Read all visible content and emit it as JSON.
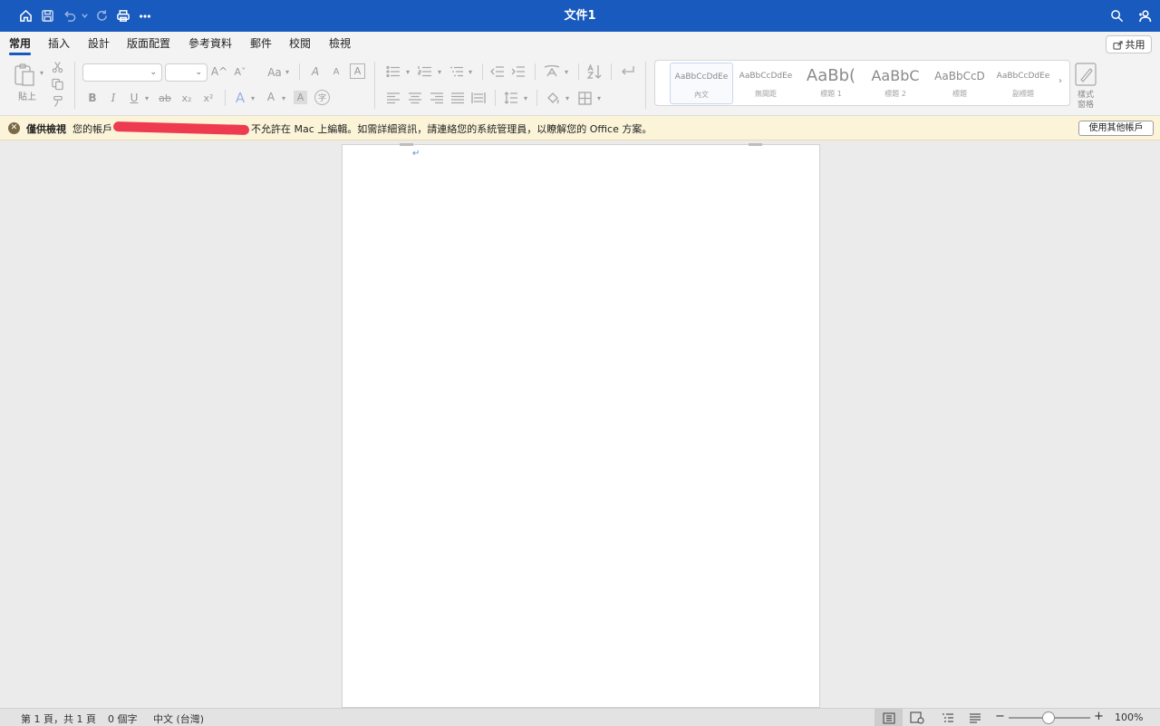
{
  "window": {
    "title": "文件1"
  },
  "tabs": [
    {
      "label": "常用",
      "active": true
    },
    {
      "label": "插入"
    },
    {
      "label": "設計"
    },
    {
      "label": "版面配置"
    },
    {
      "label": "參考資料"
    },
    {
      "label": "郵件"
    },
    {
      "label": "校閱"
    },
    {
      "label": "檢視"
    }
  ],
  "share": {
    "label": "共用"
  },
  "ribbon": {
    "paste_label": "貼上",
    "font_name": "",
    "font_size": "",
    "styles": [
      {
        "sample": "AaBbCcDdEe",
        "name": "內文",
        "selected": true
      },
      {
        "sample": "AaBbCcDdEe",
        "name": "無間距"
      },
      {
        "sample": "AaBb(",
        "name": "標題 1"
      },
      {
        "sample": "AaBbC",
        "name": "標題 2"
      },
      {
        "sample": "AaBbCcD",
        "name": "標題"
      },
      {
        "sample": "AaBbCcDdEe",
        "name": "副標題"
      }
    ],
    "styles_pane_label": "樣式\n窗格",
    "format_glyphs": {
      "bold": "B",
      "italic": "I",
      "underline": "U",
      "strike": "ab",
      "sub": "x₂",
      "sup": "x²",
      "aa": "Aa",
      "grow": "A^",
      "shrink": "Aˇ",
      "effects": "A",
      "color": "A",
      "highlight": "A",
      "enclose": "字",
      "clear": "A",
      "phonetic": "A"
    }
  },
  "notification": {
    "title": "僅供檢視",
    "message_prefix": "您的帳戶",
    "message_suffix": "不允許在 Mac 上編輯。如需詳細資訊，請連絡您的系統管理員，以瞭解您的 Office 方案。",
    "button": "使用其他帳戶"
  },
  "document": {
    "paragraph_mark": "↵"
  },
  "status": {
    "page": "第 1 頁，共 1 頁",
    "words": "0 個字",
    "language": "中文 (台灣)",
    "zoom": "100%",
    "zoom_minus": "−",
    "zoom_plus": "+"
  },
  "colors": {
    "titlebar": "#185abd",
    "notice_bg": "#fcf4d9",
    "redaction": "#ee3b4f"
  }
}
